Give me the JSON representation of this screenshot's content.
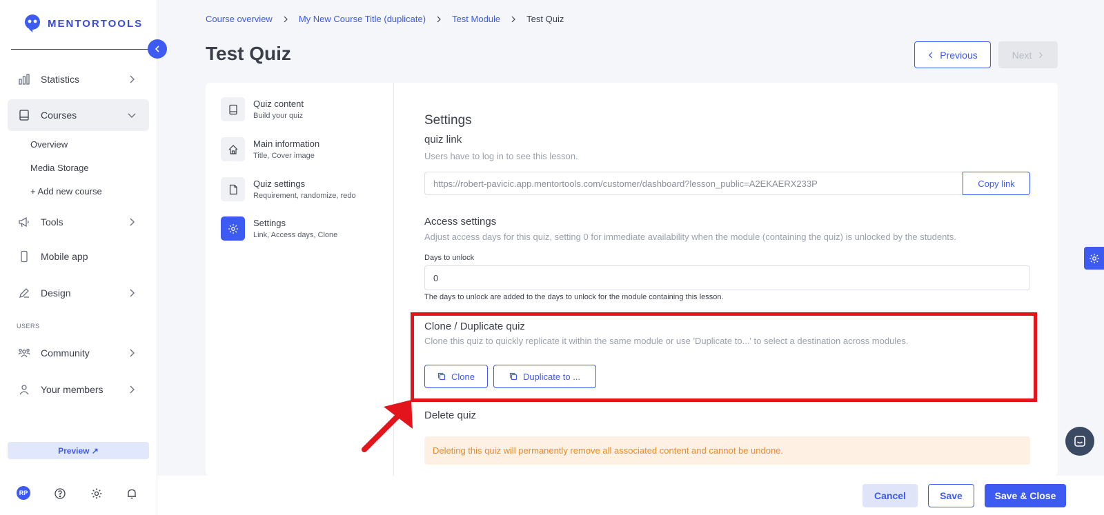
{
  "brand": {
    "name": "MENTORTOOLS",
    "accent": "#3d5af1",
    "highlight": "#e3141b"
  },
  "sidebar": {
    "items": [
      {
        "label": "Statistics",
        "icon": "bar-chart-icon"
      },
      {
        "label": "Courses",
        "icon": "book-icon",
        "active": true
      },
      {
        "label": "Tools",
        "icon": "megaphone-icon"
      },
      {
        "label": "Mobile app",
        "icon": "phone-icon"
      },
      {
        "label": "Design",
        "icon": "pencil-icon"
      },
      {
        "label": "Community",
        "icon": "community-icon"
      },
      {
        "label": "Your members",
        "icon": "user-icon"
      }
    ],
    "course_sub": [
      "Overview",
      "Media Storage",
      "+ Add new course"
    ],
    "section_users": "USERS",
    "preview_label": "Preview ↗",
    "avatar_initials": "RP"
  },
  "breadcrumb": [
    "Course overview",
    "My New Course Title (duplicate)",
    "Test Module",
    "Test Quiz"
  ],
  "page": {
    "title": "Test Quiz",
    "prev_label": "Previous",
    "next_label": "Next"
  },
  "steps": [
    {
      "title": "Quiz content",
      "subtitle": "Build your quiz",
      "icon": "book-icon"
    },
    {
      "title": "Main information",
      "subtitle": "Title, Cover image",
      "icon": "home-icon"
    },
    {
      "title": "Quiz settings",
      "subtitle": "Requirement, randomize, redo",
      "icon": "document-icon"
    },
    {
      "title": "Settings",
      "subtitle": "Link, Access days, Clone",
      "icon": "gear-icon",
      "active": true
    }
  ],
  "settings": {
    "heading": "Settings",
    "link_title": "quiz link",
    "link_desc": "Users have to log in to see this lesson.",
    "link_value": "https://robert-pavicic.app.mentortools.com/customer/dashboard?lesson_public=A2EKAERX233P",
    "copy_label": "Copy link",
    "access_title": "Access settings",
    "access_desc": "Adjust access days for this quiz, setting 0 for immediate availability when the module (containing the quiz) is unlocked by the students.",
    "days_label": "Days to unlock",
    "days_value": "0",
    "days_help": "The days to unlock are added to the days to unlock for the module containing this lesson.",
    "clone_title": "Clone / Duplicate quiz",
    "clone_desc": "Clone this quiz to quickly replicate it within the same module or use 'Duplicate to...' to select a destination across modules.",
    "clone_label": "Clone",
    "duplicate_label": "Duplicate to ...",
    "delete_title": "Delete quiz",
    "delete_warning": "Deleting this quiz will permanently remove all associated content and cannot be undone."
  },
  "footer": {
    "cancel": "Cancel",
    "save": "Save",
    "save_close": "Save & Close"
  }
}
